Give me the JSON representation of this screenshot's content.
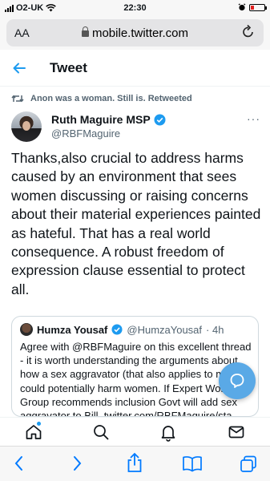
{
  "status_bar": {
    "carrier": "O2-UK",
    "time": "22:30"
  },
  "browser": {
    "text_size_label": "AA",
    "url": "mobile.twitter.com"
  },
  "header": {
    "title": "Tweet"
  },
  "tweet": {
    "retweet_note": "Anon was a woman. Still is. Retweeted",
    "author_name": "Ruth Maguire MSP",
    "author_handle": "@RBFMaguire",
    "more_label": "···",
    "body": "Thanks,also crucial to address harms caused by an environment that sees women discussing or raising concerns about their material experiences painted as hateful. That has a real world consequence. A robust freedom of expression clause essential to protect all."
  },
  "quoted_tweet": {
    "author_name": "Humza Yousaf",
    "author_handle": "@HumzaYousaf",
    "age": "· 4h",
    "text": "Agree with @RBFMaguire on this excellent thread - it is worth understanding the arguments about how a sex aggravator (that also applies to men) could potentially harm women. If Expert Working Group recommends inclusion Govt will add sex aggravator to Bill. twitter.com/RBFMaguire/sta..."
  },
  "colors": {
    "accent": "#1d9bf0",
    "ios_blue": "#007aff",
    "fab": "#5aa9e6"
  },
  "icons": {
    "tabbar": [
      "home-icon",
      "search-icon",
      "notifications-icon",
      "messages-icon"
    ],
    "toolbar": [
      "back-icon",
      "forward-icon",
      "share-icon",
      "bookmarks-icon",
      "tabs-icon"
    ]
  }
}
